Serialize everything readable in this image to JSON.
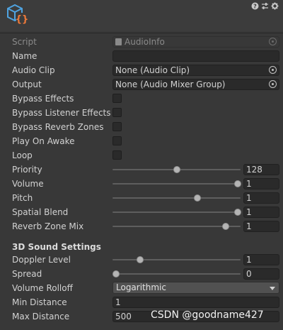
{
  "header": {
    "script_icon": "csharp-script-icon",
    "icons": [
      "help-icon",
      "preset-icon",
      "settings-icon"
    ]
  },
  "script": {
    "label": "Script",
    "value": "AudioInfo"
  },
  "name": {
    "label": "Name",
    "value": ""
  },
  "audio_clip": {
    "label": "Audio Clip",
    "value": "None (Audio Clip)"
  },
  "output": {
    "label": "Output",
    "value": "None (Audio Mixer Group)"
  },
  "toggles": [
    {
      "label": "Bypass Effects",
      "checked": false
    },
    {
      "label": "Bypass Listener Effects",
      "checked": false
    },
    {
      "label": "Bypass Reverb Zones",
      "checked": false
    },
    {
      "label": "Play On Awake",
      "checked": false
    },
    {
      "label": "Loop",
      "checked": false
    }
  ],
  "sliders": [
    {
      "label": "Priority",
      "value": "128",
      "fraction": 0.5
    },
    {
      "label": "Volume",
      "value": "1",
      "fraction": 1.0
    },
    {
      "label": "Pitch",
      "value": "1",
      "fraction": 0.67
    },
    {
      "label": "Spatial Blend",
      "value": "1",
      "fraction": 1.0
    },
    {
      "label": "Reverb Zone Mix",
      "value": "1",
      "fraction": 0.9
    }
  ],
  "sound3d": {
    "heading": "3D Sound Settings",
    "doppler": {
      "label": "Doppler Level",
      "value": "1",
      "fraction": 0.2
    },
    "spread": {
      "label": "Spread",
      "value": "0",
      "fraction": 0.0
    },
    "rolloff": {
      "label": "Volume Rolloff",
      "value": "Logarithmic"
    },
    "min_distance": {
      "label": "Min Distance",
      "value": "1"
    },
    "max_distance": {
      "label": "Max Distance",
      "value": "500"
    }
  },
  "watermark": "CSDN @goodname427"
}
